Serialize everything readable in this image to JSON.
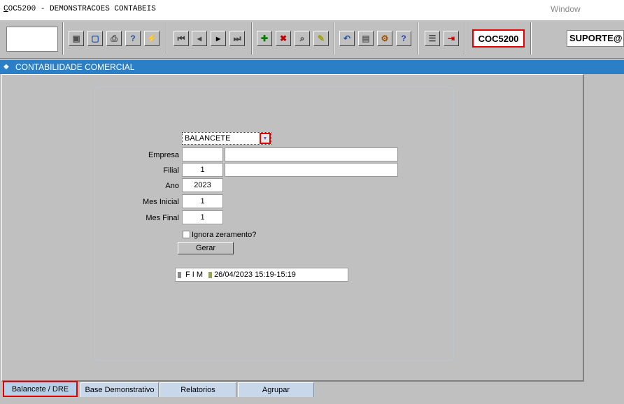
{
  "window": {
    "title_prefix": "C",
    "title_rest": "OC5200 - DEMONSTRACOES CONTABEIS",
    "menu_window": "Window"
  },
  "toolbar": {
    "buttons": [
      {
        "name": "save-icon",
        "glyph": "▣"
      },
      {
        "name": "window-icon",
        "glyph": "▢"
      },
      {
        "name": "print-icon",
        "glyph": "⎙"
      },
      {
        "name": "query-help-icon",
        "glyph": "?"
      },
      {
        "name": "execute-query-icon",
        "glyph": "⚡"
      },
      {
        "name": "first-record-icon",
        "glyph": "⏮"
      },
      {
        "name": "previous-record-icon",
        "glyph": "◂"
      },
      {
        "name": "next-record-icon",
        "glyph": "▸"
      },
      {
        "name": "last-record-icon",
        "glyph": "⏭"
      },
      {
        "name": "insert-record-icon",
        "glyph": "✚"
      },
      {
        "name": "delete-record-icon",
        "glyph": "✖"
      },
      {
        "name": "search-icon",
        "glyph": "⌕"
      },
      {
        "name": "clear-icon",
        "glyph": "✎"
      },
      {
        "name": "undo-icon",
        "glyph": "↶"
      },
      {
        "name": "clipboard-icon",
        "glyph": "▤"
      },
      {
        "name": "settings-icon",
        "glyph": "⚙"
      },
      {
        "name": "help-icon",
        "glyph": "?"
      },
      {
        "name": "menu-icon",
        "glyph": "☰"
      },
      {
        "name": "exit-icon",
        "glyph": "⇥"
      }
    ],
    "program_code": "COC5200",
    "user": "SUPORTE@"
  },
  "section": {
    "title": "CONTABILIDADE COMERCIAL"
  },
  "form": {
    "report_type": "BALANCETE",
    "empresa_label": "Empresa",
    "empresa_code": "",
    "empresa_name": "",
    "filial_label": "Filial",
    "filial_code": "1",
    "filial_name": "",
    "ano_label": "Ano",
    "ano_value": "2023",
    "mes_inicial_label": "Mes Inicial",
    "mes_inicial_value": "1",
    "mes_final_label": "Mes Final",
    "mes_final_value": "1",
    "ignora_label": "Ignora zeramento?",
    "gerar_label": "Gerar",
    "status_fim": "F I M",
    "status_time": "26/04/2023 15:19-15:19"
  },
  "tabs": [
    {
      "label": "Balancete / DRE",
      "active": true
    },
    {
      "label": "Base Demonstrativo",
      "active": false
    },
    {
      "label": "Relatorios",
      "active": false
    },
    {
      "label": "Agrupar",
      "active": false
    }
  ],
  "colors": {
    "header_blue": "#2a7fc6",
    "highlight_red": "#e00000",
    "tab_blue": "#c8d8ea"
  }
}
